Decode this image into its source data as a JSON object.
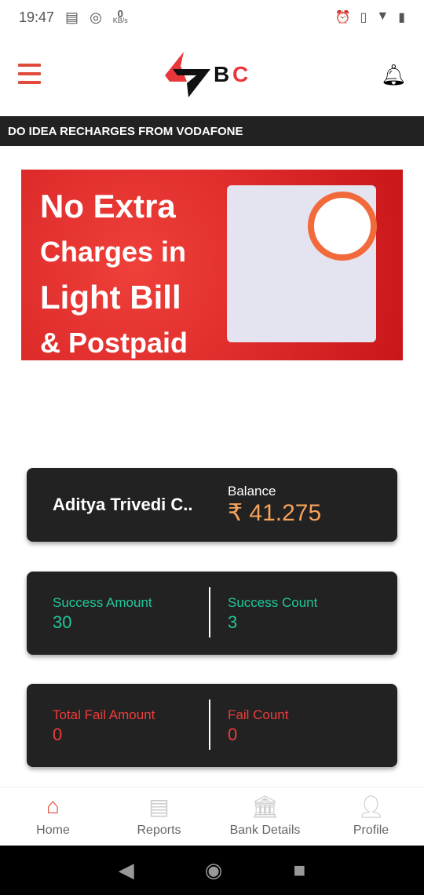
{
  "status_bar": {
    "time": "19:47",
    "net_speed": "0",
    "net_unit": "KB/s"
  },
  "header": {
    "logo_text": "47BC"
  },
  "ticker": {
    "text": "DO IDEA RECHARGES FROM VODAFONE"
  },
  "banner": {
    "line1": "No Extra",
    "line2": "Charges in",
    "line3": "Light Bill",
    "line4": "& Postpaid"
  },
  "balance_card": {
    "name": "Aditya Trivedi C..",
    "label": "Balance",
    "value": "₹ 41.275"
  },
  "success_card": {
    "amount_label": "Success Amount",
    "amount": "30",
    "count_label": "Success Count",
    "count": "3"
  },
  "fail_card": {
    "amount_label": "Total Fail Amount",
    "amount": "0",
    "count_label": "Fail Count",
    "count": "0"
  },
  "bottom_nav": [
    {
      "label": "Home",
      "icon": "home-icon",
      "active": true
    },
    {
      "label": "Reports",
      "icon": "clipboard-icon"
    },
    {
      "label": "Bank Details",
      "icon": "bank-icon"
    },
    {
      "label": "Profile",
      "icon": "user-icon"
    }
  ],
  "colors": {
    "accent": "#e04a3a",
    "success": "#1fc79a",
    "fail": "#ef3b3b",
    "balance": "#f5a25a",
    "card": "#222222"
  }
}
